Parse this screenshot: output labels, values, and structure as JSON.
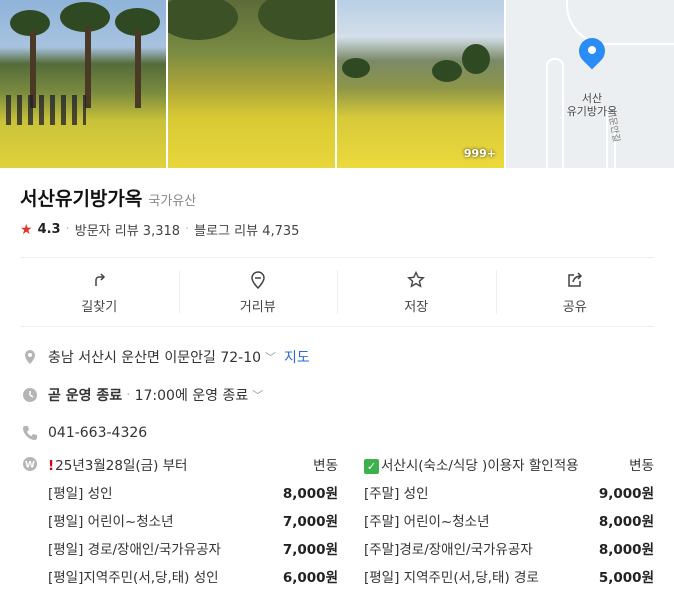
{
  "photos": {
    "badge": "999+"
  },
  "map": {
    "label_line1": "서산",
    "label_line2": "유기방가옥",
    "road_label": "이문안길"
  },
  "place": {
    "title": "서산유기방가옥",
    "category": "국가유산",
    "rating": "4.3",
    "visitor_reviews": "방문자 리뷰 3,318",
    "blog_reviews": "블로그 리뷰 4,735"
  },
  "actions": [
    {
      "label": "길찾기",
      "icon": "directions-icon"
    },
    {
      "label": "거리뷰",
      "icon": "street-view-icon"
    },
    {
      "label": "저장",
      "icon": "star-outline-icon"
    },
    {
      "label": "공유",
      "icon": "share-icon"
    }
  ],
  "info": {
    "address": "충남 서산시 운산면 이문안길 72-10",
    "map_link": "지도",
    "status": "곧 운영 종료",
    "hours": "17:00에 운영 종료",
    "phone": "041-663-4326"
  },
  "prices": {
    "header_left": "25년3월28일(금) 부터",
    "header_left_tag": "변동",
    "header_right": "서산시(숙소/식당 )이용자 할인적용",
    "header_right_tag": "변동",
    "rows": [
      {
        "left_label": "[평일] 성인",
        "left_amount": "8,000원",
        "right_label": "[주말] 성인",
        "right_amount": "9,000원"
      },
      {
        "left_label": "[평일] 어린이~청소년",
        "left_amount": "7,000원",
        "right_label": "[주말] 어린이~청소년",
        "right_amount": "8,000원"
      },
      {
        "left_label": "[평일] 경로/장애인/국가유공자",
        "left_amount": "7,000원",
        "right_label": "[주말]경로/장애인/국가유공자",
        "right_amount": "8,000원"
      },
      {
        "left_label": "[평일]지역주민(서,당,태) 성인",
        "left_amount": "6,000원",
        "right_label": "[평일] 지역주민(서,당,태) 경로",
        "right_amount": "5,000원"
      }
    ]
  },
  "colors": {
    "accent": "#2b8cf6",
    "star": "#e2342a",
    "link": "#2b6cd6",
    "check": "#3db14b"
  }
}
